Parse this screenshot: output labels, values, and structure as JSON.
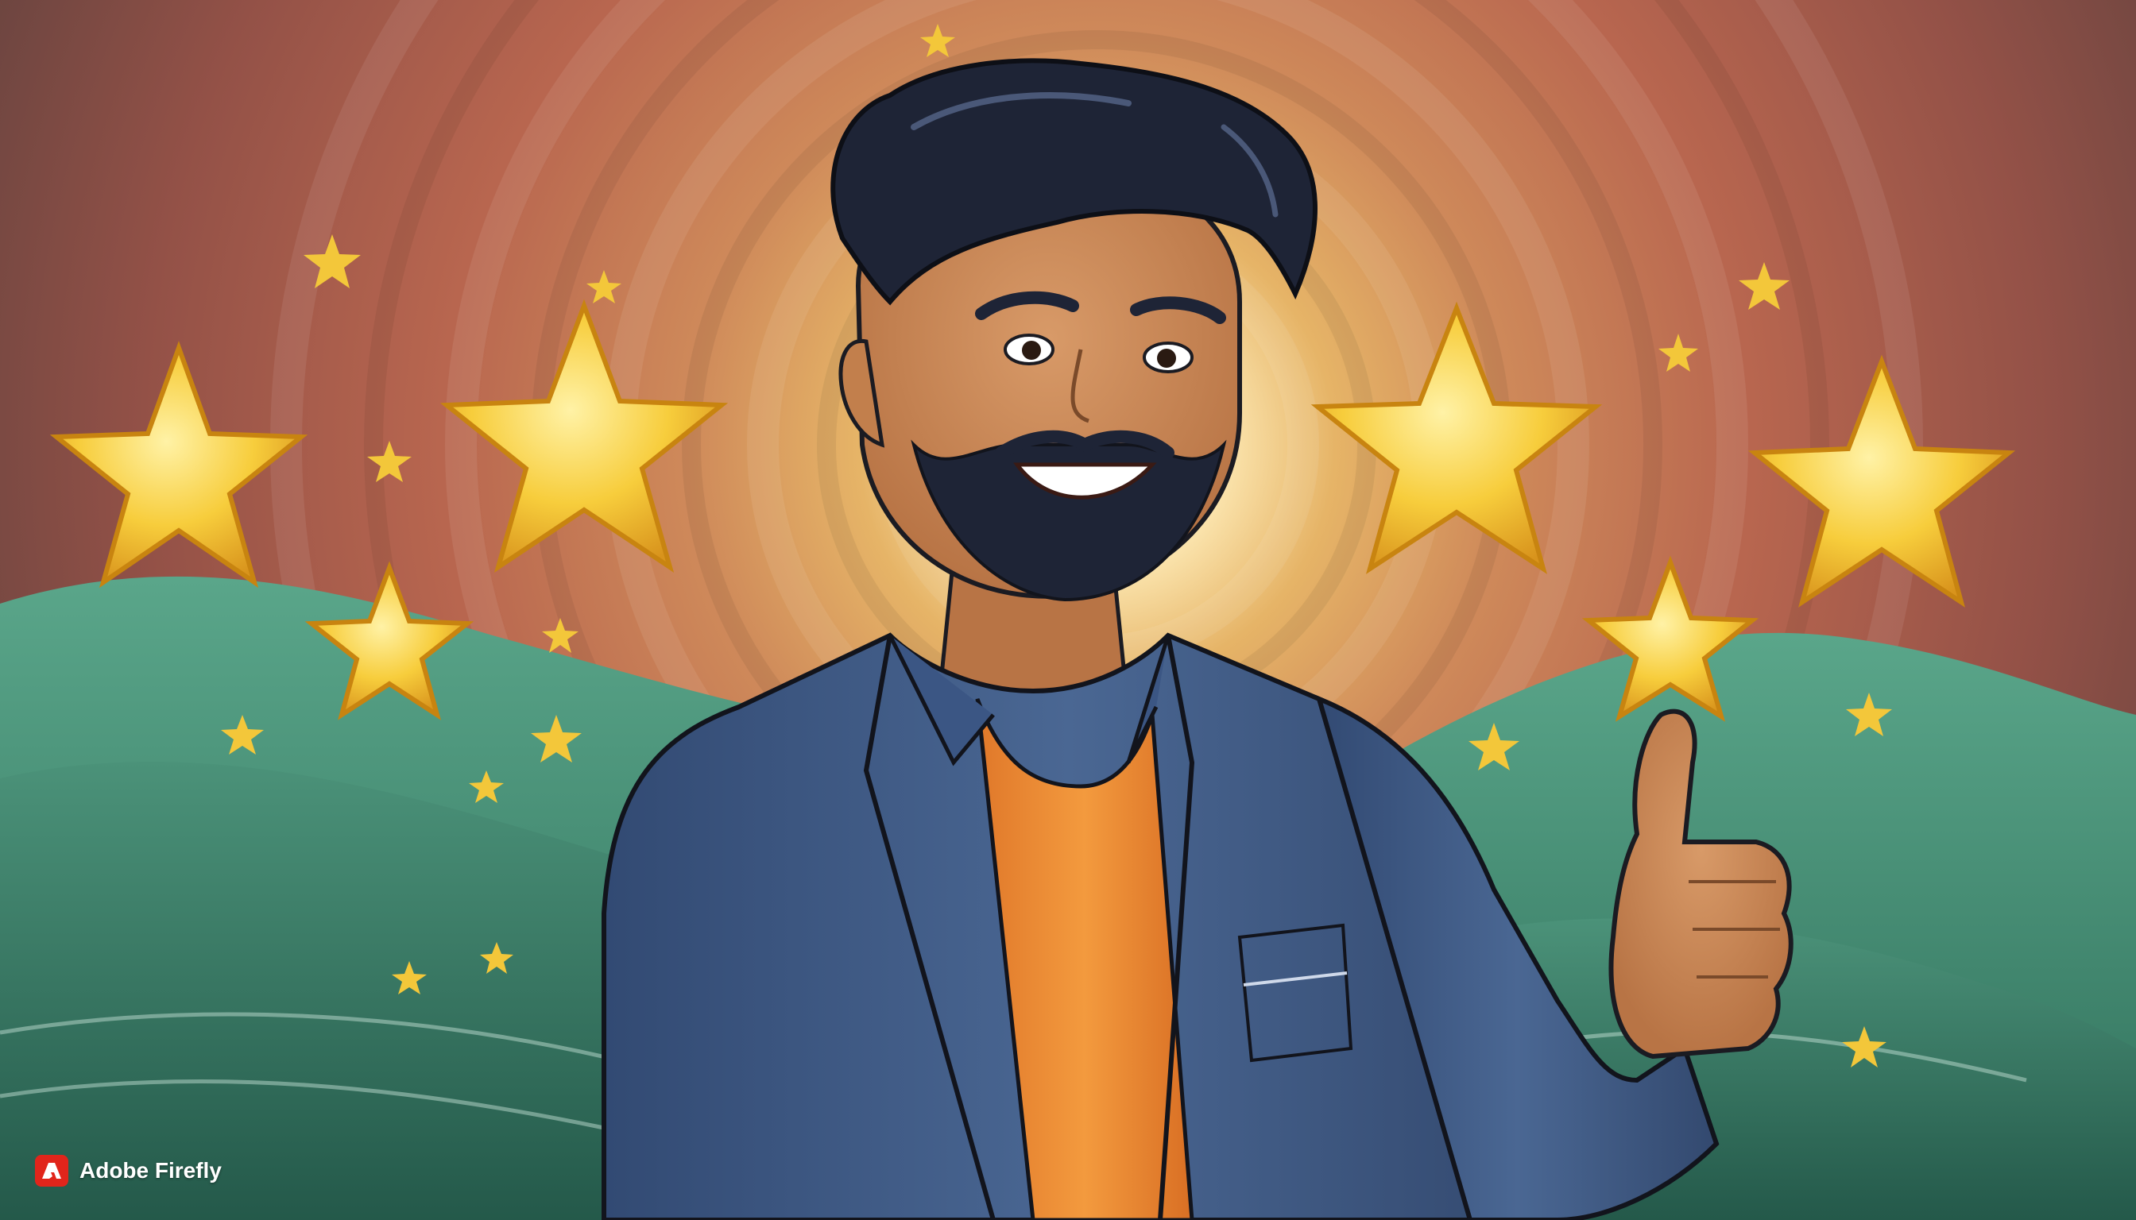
{
  "image": {
    "description_colors": {
      "sky_warm": "#b8654f",
      "sky_glow": "#fff5d8",
      "hills": "#3f8a70",
      "shirt": "#3f5b85",
      "tshirt": "#ef8a2c",
      "skin": "#c98755",
      "hair": "#1e2436",
      "star": "#f6c630"
    }
  },
  "watermark": {
    "text": "Adobe Firefly",
    "icon": "adobe-logo-icon"
  }
}
